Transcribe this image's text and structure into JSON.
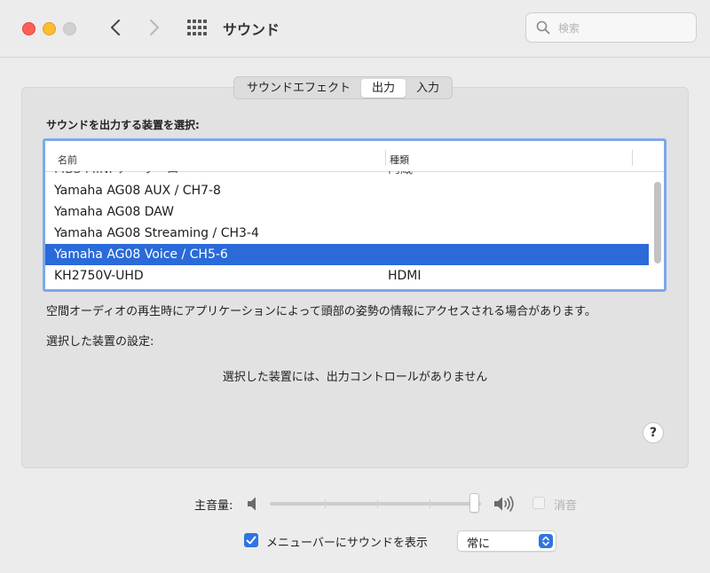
{
  "window": {
    "title": "サウンド"
  },
  "search": {
    "placeholder": "検索",
    "value": ""
  },
  "tabs": [
    {
      "label": "サウンドエフェクト",
      "active": false
    },
    {
      "label": "出力",
      "active": true
    },
    {
      "label": "入力",
      "active": false
    }
  ],
  "output": {
    "heading": "サウンドを出力する装置を選択:",
    "columns": {
      "name": "名前",
      "kind": "種類"
    },
    "rows": [
      {
        "name": "MBS MINI-ア・リーロ",
        "kind": "内蔵",
        "partial": true
      },
      {
        "name": "Yamaha AG08 AUX / CH7-8",
        "kind": ""
      },
      {
        "name": "Yamaha AG08 DAW",
        "kind": ""
      },
      {
        "name": "Yamaha AG08 Streaming / CH3-4",
        "kind": ""
      },
      {
        "name": "Yamaha AG08 Voice / CH5-6",
        "kind": "",
        "selected": true
      },
      {
        "name": "KH2750V-UHD",
        "kind": "HDMI"
      }
    ],
    "note": "空間オーディオの再生時にアプリケーションによって頭部の姿勢の情報にアクセスされる場合があります。",
    "selected_settings_label": "選択した装置の設定:",
    "no_controls_message": "選択した装置には、出力コントロールがありません",
    "help_label": "?"
  },
  "volume": {
    "label": "主音量:",
    "level": 0.97,
    "mute_label": "消音",
    "mute_checked": false,
    "mute_enabled": false
  },
  "menubar": {
    "label": "メニューバーにサウンドを表示",
    "checked": true,
    "popup_value": "常に"
  },
  "colors": {
    "selection": "#2a6ad9",
    "accent": "#2f74e0",
    "focus_ring": "#7fa8e8"
  }
}
